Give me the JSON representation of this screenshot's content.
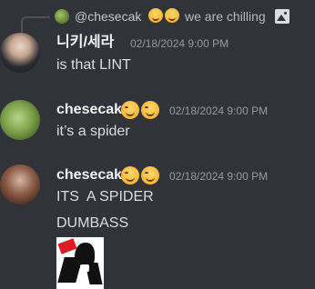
{
  "reply": {
    "author": "@chesecak",
    "text": "we are chilling",
    "icon": "image-icon"
  },
  "messages": [
    {
      "author": "니키/세라",
      "timestamp": "02/18/2024 9:00 PM",
      "lines": [
        "is that LINT"
      ],
      "avatar": "avatar"
    },
    {
      "author": "chesecak",
      "timestamp": "02/18/2024 9:00 PM",
      "lines": [
        "it’s a spider"
      ],
      "emojis": [
        "drooling-face-emoji",
        "drooling-face-emoji"
      ],
      "avatar": "avatar"
    },
    {
      "author": "chesecak",
      "timestamp": "02/18/2024 9:00 PM",
      "lines": [
        "ITS  A SPIDER",
        "DUMBASS"
      ],
      "emojis": [
        "drooling-face-emoji",
        "drooling-face-emoji"
      ],
      "avatar": "avatar",
      "attachment": "image-attachment"
    }
  ],
  "colors": {
    "background": "#313338",
    "username": "#f2f3f5",
    "text": "#dbdee1",
    "timestamp": "#949ba4",
    "reply_line": "#4e5058"
  }
}
